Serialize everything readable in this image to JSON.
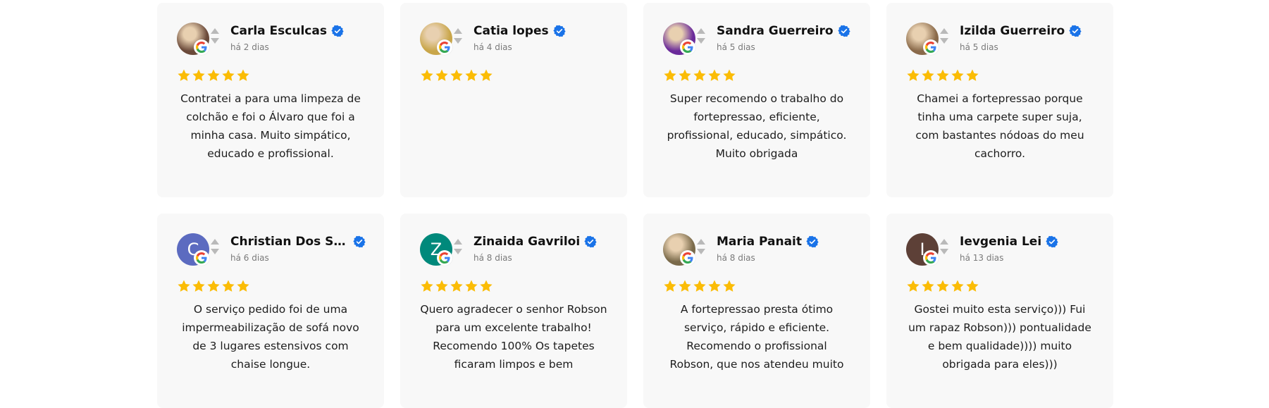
{
  "reviews": [
    {
      "name": "Carla Esculcas",
      "date": "há 2 dias",
      "rating": 5,
      "avatar_type": "photo",
      "avatar_color": "#6b4a3a",
      "avatar_initial": "",
      "text": "Contratei a para uma limpeza de colchão e foi o Álvaro que foi a minha casa. Muito simpático, educado e profissional."
    },
    {
      "name": "Catia lopes",
      "date": "há 4 dias",
      "rating": 5,
      "avatar_type": "photo",
      "avatar_color": "#c9a64a",
      "avatar_initial": "",
      "text": ""
    },
    {
      "name": "Sandra Guerreiro",
      "date": "há 5 dias",
      "rating": 5,
      "avatar_type": "photo",
      "avatar_color": "#6a2a9a",
      "avatar_initial": "",
      "text": "Super recomendo o trabalho do fortepressao, eficiente, profissional, educado, simpático. Muito obrigada"
    },
    {
      "name": "Izilda Guerreiro",
      "date": "há 5 dias",
      "rating": 5,
      "avatar_type": "photo",
      "avatar_color": "#8a6a4a",
      "avatar_initial": "",
      "text": "Chamei a fortepressao porque tinha uma carpete super suja, com bastantes nódoas do meu cachorro."
    },
    {
      "name": "Christian Dos Sant...",
      "date": "há 6 dias",
      "rating": 5,
      "avatar_type": "initial",
      "avatar_color": "#5c6bc0",
      "avatar_initial": "C",
      "text": "O serviço pedido foi de uma impermeabilização de sofá novo de 3 lugares estensivos com chaise longue."
    },
    {
      "name": "Zinaida Gavriloi",
      "date": "há 8 dias",
      "rating": 5,
      "avatar_type": "initial",
      "avatar_color": "#00897b",
      "avatar_initial": "Z",
      "text": "Quero agradecer o senhor Robson para um excelente trabalho! Recomendo 100% Os tapetes ficaram limpos e bem"
    },
    {
      "name": "Maria Panait",
      "date": "há 8 dias",
      "rating": 5,
      "avatar_type": "photo",
      "avatar_color": "#7a6a4a",
      "avatar_initial": "",
      "text": "A fortepressao presta ótimo serviço, rápido e eficiente. Recomendo o profissional Robson, que nos atendeu muito"
    },
    {
      "name": "Ievgenia Lei",
      "date": "há 13 dias",
      "rating": 5,
      "avatar_type": "initial",
      "avatar_color": "#5d4037",
      "avatar_initial": "I",
      "text": "Gostei muito esta serviço))) Fui um rapaz Robson))) pontualidade e bem qualidade)))) muito obrigada para eles)))"
    }
  ],
  "colors": {
    "star": "#fbbc05",
    "verified": "#1a73e8",
    "card_bg": "#f8f8f8"
  }
}
